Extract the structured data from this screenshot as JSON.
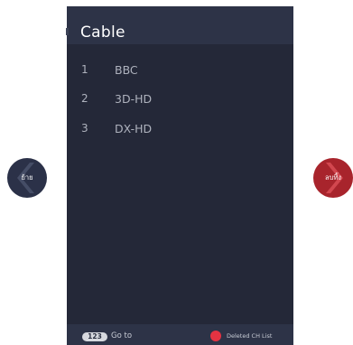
{
  "panel": {
    "title": "Cable"
  },
  "channels": [
    {
      "number": "1",
      "name": "BBC"
    },
    {
      "number": "2",
      "name": "3D-HD"
    },
    {
      "number": "3",
      "name": "DX-HD"
    }
  ],
  "footer": {
    "key_badge": "123",
    "goto_label": "Go to",
    "deleted_label": "Deleted CH List"
  },
  "buttons": {
    "move_label": "ย้าย",
    "delete_label": "ลบทิ้ง"
  },
  "colors": {
    "panel_bg": "#242838",
    "header_bg": "#2d3347",
    "delete_red": "#e53342",
    "move_btn_bg": "#2b3148",
    "delete_btn_bg": "#a8242c"
  },
  "icons": {
    "move": "chevron-left-icon",
    "delete": "chevron-right-icon"
  }
}
